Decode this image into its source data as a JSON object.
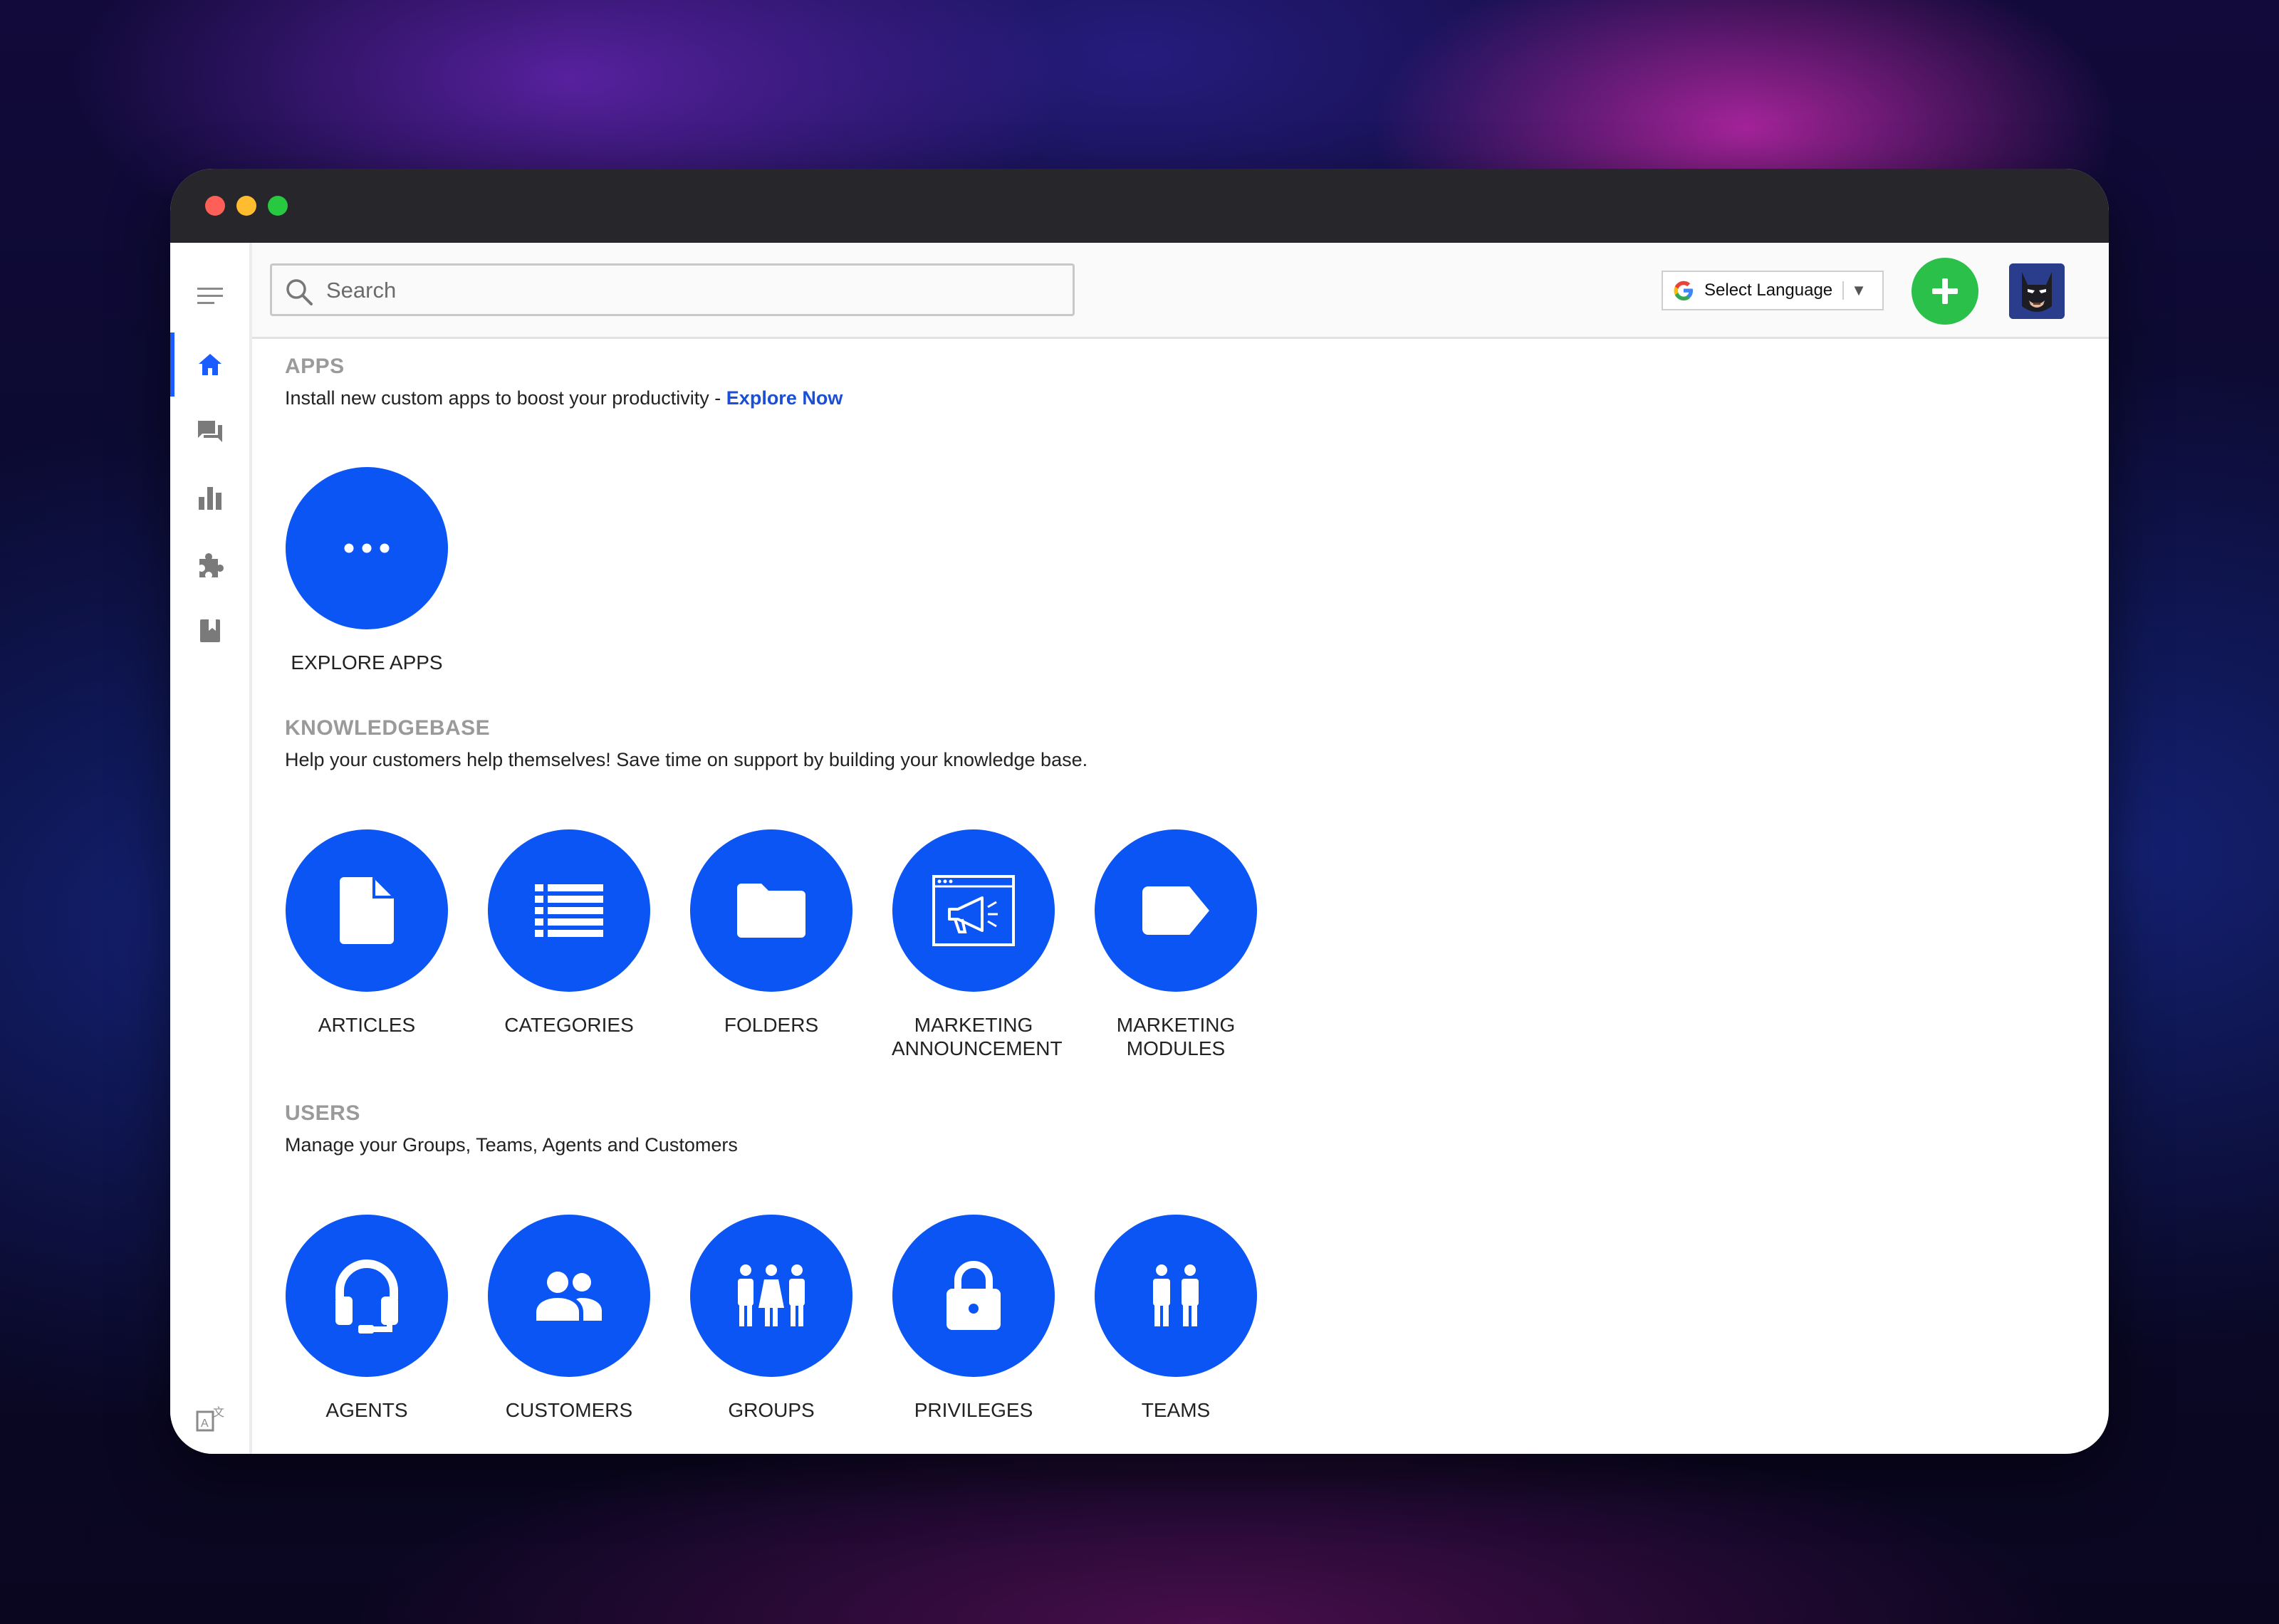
{
  "header": {
    "search_placeholder": "Search",
    "language_label": "Select Language",
    "language_arrow": "▼"
  },
  "sidebar": {
    "items": [
      {
        "icon": "menu-icon"
      },
      {
        "icon": "home-icon"
      },
      {
        "icon": "chat-icon"
      },
      {
        "icon": "bar-chart-icon"
      },
      {
        "icon": "puzzle-icon"
      },
      {
        "icon": "bookmark-book-icon"
      },
      {
        "icon": "translate-icon"
      }
    ]
  },
  "apps": {
    "title": "APPS",
    "description": "Install new custom apps to boost your productivity - ",
    "link": "Explore Now",
    "tiles": [
      {
        "label": "EXPLORE APPS",
        "icon": "more-dots-icon"
      }
    ]
  },
  "knowledgebase": {
    "title": "KNOWLEDGEBASE",
    "description": "Help your customers help themselves! Save time on support by building your knowledge base.",
    "tiles": [
      {
        "label": "ARTICLES",
        "icon": "document-icon"
      },
      {
        "label": "CATEGORIES",
        "icon": "list-icon"
      },
      {
        "label": "FOLDERS",
        "icon": "folder-icon"
      },
      {
        "label": "MARKETING\nANNOUNCEMENT",
        "icon": "megaphone-window-icon"
      },
      {
        "label": "MARKETING\nMODULES",
        "icon": "label-tag-icon"
      }
    ]
  },
  "users": {
    "title": "USERS",
    "description": "Manage your Groups, Teams, Agents and Customers",
    "tiles": [
      {
        "label": "AGENTS",
        "icon": "headset-icon"
      },
      {
        "label": "CUSTOMERS",
        "icon": "people-icon"
      },
      {
        "label": "GROUPS",
        "icon": "group-people-icon"
      },
      {
        "label": "PRIVILEGES",
        "icon": "lock-icon"
      },
      {
        "label": "TEAMS",
        "icon": "team-icon"
      }
    ]
  },
  "colors": {
    "accent_blue": "#0c55f5",
    "add_green": "#2bc04a",
    "link_blue": "#1a4fd6",
    "section_gray": "#9a9a9a"
  }
}
